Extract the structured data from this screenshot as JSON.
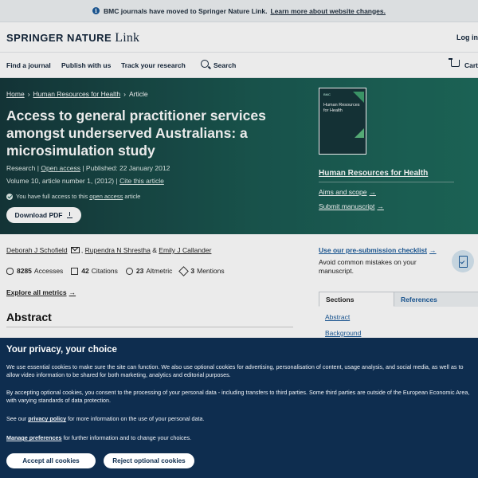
{
  "banner": {
    "text": "BMC journals have moved to Springer Nature Link.",
    "link": "Learn more about website changes."
  },
  "header": {
    "brand": "SPRINGER NATURE",
    "brand_link": "Link",
    "login": "Log in"
  },
  "nav": {
    "items": [
      "Find a journal",
      "Publish with us",
      "Track your research"
    ],
    "search": "Search",
    "cart": "Cart"
  },
  "breadcrumb": [
    "Home",
    "Human Resources for Health",
    "Article"
  ],
  "article": {
    "title": "Access to general practitioner services amongst underserved Australians: a microsimulation study",
    "type": "Research",
    "open_access": "Open access",
    "published": "Published: 22 January 2012",
    "volume": "Volume 10, article number 1, (2012)",
    "cite": "Cite this article",
    "access_prefix": "You have full access to this",
    "access_link": "open access",
    "access_suffix": "article",
    "download": "Download PDF"
  },
  "journal": {
    "cover_publisher": "BMC",
    "cover_title": "Human Resources for Health",
    "name": "Human Resources for Health",
    "links": [
      "Aims and scope",
      "Submit manuscript"
    ]
  },
  "authors": [
    "Deborah J Schofield",
    "Rupendra N Shrestha",
    "Emily J Callander"
  ],
  "metrics": [
    {
      "icon": "eye-icon",
      "value": "8285",
      "label": "Accesses"
    },
    {
      "icon": "citations-icon",
      "value": "42",
      "label": "Citations"
    },
    {
      "icon": "altmetric-icon",
      "value": "23",
      "label": "Altmetric"
    },
    {
      "icon": "mentions-icon",
      "value": "3",
      "label": "Mentions"
    }
  ],
  "explore_metrics": "Explore all metrics",
  "abstract_heading": "Abstract",
  "sidebar": {
    "checklist_link": "Use our pre-submission checklist",
    "checklist_desc": "Avoid common mistakes on your manuscript.",
    "tabs": [
      "Sections",
      "References"
    ],
    "toc": [
      "Abstract",
      "Background"
    ]
  },
  "cookie": {
    "title": "Your privacy, your choice",
    "p1": "We use essential cookies to make sure the site can function. We also use optional cookies for advertising, personalisation of content, usage analysis, and social media, as well as to allow video information to be shared for both marketing, analytics and editorial purposes.",
    "p2": "By accepting optional cookies, you consent to the processing of your personal data - including transfers to third parties. Some third parties are outside of the European Economic Area, with varying standards of data protection.",
    "p3_prefix": "See our",
    "p3_link": "privacy policy",
    "p3_suffix": "for more information on the use of your personal data.",
    "p4_link": "Manage preferences",
    "p4_suffix": "for further information and to change your choices.",
    "accept": "Accept all cookies",
    "reject": "Reject optional cookies"
  }
}
